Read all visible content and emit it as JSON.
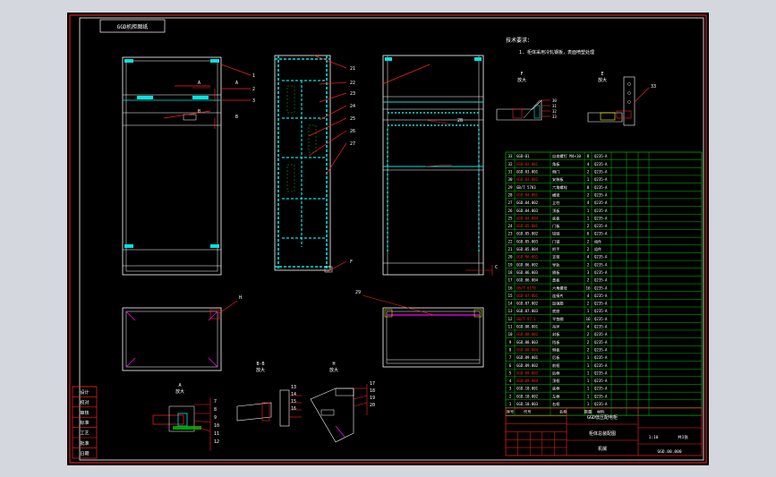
{
  "drawing": {
    "title_block_top_label": "GGD机柜图纸",
    "notes_title": "技术要求：",
    "notes_line": "1. 柜体采用冷轧钢板，表面喷塑处理",
    "view_f": "F\n放大",
    "view_e": "E\n放大",
    "view_a": "A\n放大",
    "view_b": "B-B\n放大",
    "view_h": "H\n放大",
    "view_c": "C",
    "front_labels": [
      "1",
      "2",
      "3",
      "A",
      "A",
      "B",
      "B"
    ],
    "mid_labels": [
      "21",
      "22",
      "23",
      "24",
      "25",
      "26",
      "27",
      "F"
    ],
    "right_labels": [
      "28"
    ],
    "plan_label_h": "H",
    "plan_label_29": "29",
    "detail_labels_a": [
      "7",
      "8",
      "9",
      "10",
      "11",
      "12"
    ],
    "detail_labels_b": [
      "13",
      "14",
      "15",
      "16"
    ],
    "detail_labels_h": [
      "17",
      "18",
      "19",
      "20"
    ],
    "f_labels": [
      "30",
      "31",
      "32",
      "33"
    ],
    "e_label": "33",
    "left_strip": [
      "设计",
      "校对",
      "审核",
      "标准",
      "工艺",
      "批准",
      "日期"
    ],
    "bom_rows": [
      {
        "n": "33",
        "code": "GGD-01",
        "name": "自攻螺钉 M4×10",
        "q": "8",
        "m": "Q235-A"
      },
      {
        "n": "32",
        "code": "GGD.02.001",
        "name": "角板",
        "q": "4",
        "m": "Q235-A"
      },
      {
        "n": "31",
        "code": "GGD.03.001",
        "name": "侧门",
        "q": "2",
        "m": "Q235-A"
      },
      {
        "n": "30",
        "code": "GGD.03.002",
        "name": "安装板",
        "q": "1",
        "m": "Q235-A"
      },
      {
        "n": "29",
        "code": "GB/T 5783",
        "name": "六角螺栓",
        "q": "8",
        "m": "Q235-A"
      },
      {
        "n": "28",
        "code": "GGD.04.001",
        "name": "横梁",
        "q": "2",
        "m": "Q235-A"
      },
      {
        "n": "27",
        "code": "GGD.04.002",
        "name": "立柱",
        "q": "4",
        "m": "Q235-A"
      },
      {
        "n": "26",
        "code": "GGD.04.003",
        "name": "顶板",
        "q": "1",
        "m": "Q235-A"
      },
      {
        "n": "25",
        "code": "GGD.04.004",
        "name": "底板",
        "q": "1",
        "m": "Q235-A"
      },
      {
        "n": "24",
        "code": "GGD.05.001",
        "name": "门板",
        "q": "2",
        "m": "Q235-A"
      },
      {
        "n": "23",
        "code": "GGD.05.002",
        "name": "铰链",
        "q": "6",
        "m": "Q235-A"
      },
      {
        "n": "22",
        "code": "GGD.05.003",
        "name": "门锁",
        "q": "2",
        "m": "组件"
      },
      {
        "n": "21",
        "code": "GGD.05.004",
        "name": "把手",
        "q": "2",
        "m": "组件"
      },
      {
        "n": "20",
        "code": "GGD.06.001",
        "name": "支架",
        "q": "4",
        "m": "Q235-A"
      },
      {
        "n": "19",
        "code": "GGD.06.002",
        "name": "导轨",
        "q": "2",
        "m": "Q235-A"
      },
      {
        "n": "18",
        "code": "GGD.06.003",
        "name": "隔板",
        "q": "3",
        "m": "Q235-A"
      },
      {
        "n": "17",
        "code": "GGD.06.004",
        "name": "盖板",
        "q": "2",
        "m": "Q235-A"
      },
      {
        "n": "16",
        "code": "GB/T 6170",
        "name": "六角螺母",
        "q": "16",
        "m": "Q235-A"
      },
      {
        "n": "15",
        "code": "GGD.07.001",
        "name": "连接片",
        "q": "4",
        "m": "Q235-A"
      },
      {
        "n": "14",
        "code": "GGD.07.002",
        "name": "加强筋",
        "q": "2",
        "m": "Q235-A"
      },
      {
        "n": "13",
        "code": "GGD.07.003",
        "name": "底座",
        "q": "1",
        "m": "Q235-A"
      },
      {
        "n": "12",
        "code": "GB/T 97.1",
        "name": "平垫圈",
        "q": "16",
        "m": "Q235-A"
      },
      {
        "n": "11",
        "code": "GGD.08.001",
        "name": "吊环",
        "q": "4",
        "m": "Q235-A"
      },
      {
        "n": "10",
        "code": "GGD.08.002",
        "name": "封板",
        "q": "2",
        "m": "Q235-A"
      },
      {
        "n": "9",
        "code": "GGD.08.003",
        "name": "挡板",
        "q": "2",
        "m": "Q235-A"
      },
      {
        "n": "8",
        "code": "GGD.08.004",
        "name": "侧板",
        "q": "2",
        "m": "Q235-A"
      },
      {
        "n": "7",
        "code": "GGD.09.001",
        "name": "后板",
        "q": "1",
        "m": "Q235-A"
      },
      {
        "n": "6",
        "code": "GGD.09.002",
        "name": "前框",
        "q": "1",
        "m": "Q235-A"
      },
      {
        "n": "5",
        "code": "GGD.09.003",
        "name": "后框",
        "q": "1",
        "m": "Q235-A"
      },
      {
        "n": "4",
        "code": "GGD.09.004",
        "name": "顶框",
        "q": "1",
        "m": "Q235-A"
      },
      {
        "n": "3",
        "code": "GGD.10.001",
        "name": "底框",
        "q": "1",
        "m": "Q235-A"
      },
      {
        "n": "2",
        "code": "GGD.10.002",
        "name": "左框",
        "q": "1",
        "m": "Q235-A"
      },
      {
        "n": "1",
        "code": "GGD.10.003",
        "name": "右框",
        "q": "1",
        "m": "Q235-A"
      }
    ],
    "bom_header": {
      "n": "序号",
      "code": "代号",
      "name": "名称",
      "q": "数量",
      "m": "材料"
    },
    "title_block": {
      "project": "GGD低压配电柜",
      "assembly": "柜体总装配图",
      "company": "机械",
      "code": "GGD.00.000",
      "scale": "1:10",
      "sheet": "共1张"
    },
    "colors": {
      "line": "#ffffff",
      "cyan": "#00e5e5",
      "green": "#00c000",
      "red": "#ff2020",
      "magenta": "#ff00ff",
      "yellow": "#ffff00"
    }
  }
}
